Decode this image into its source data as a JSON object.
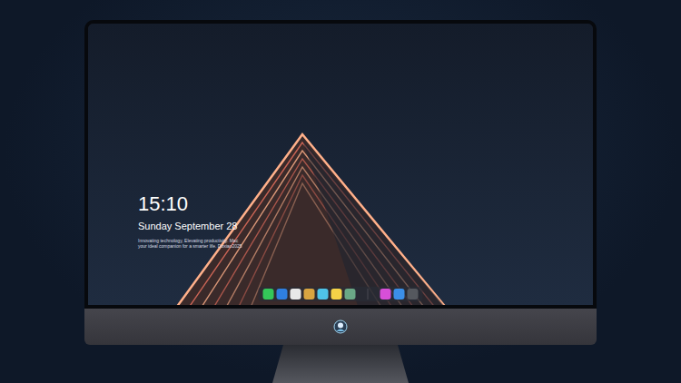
{
  "desktop": {
    "clock": {
      "time": "15:10",
      "date": "Sunday September 28"
    },
    "tagline": [
      "Innovating technology, Elevating productivity. Mac",
      "your ideal companion for a smarter life. Doxiao2025"
    ]
  },
  "dock": {
    "apps": [
      {
        "color": "#34c759"
      },
      {
        "color": "#2f7fe0"
      },
      {
        "color": "#e8e8e8"
      },
      {
        "color": "#d9a441"
      },
      {
        "color": "#4fc3e8"
      },
      {
        "color": "#f5d247"
      },
      {
        "color": "#6aa886"
      }
    ],
    "recent": [
      {
        "color": "#d84fd8"
      },
      {
        "color": "#3b8fe8"
      },
      {
        "color": "#55585e"
      }
    ]
  }
}
